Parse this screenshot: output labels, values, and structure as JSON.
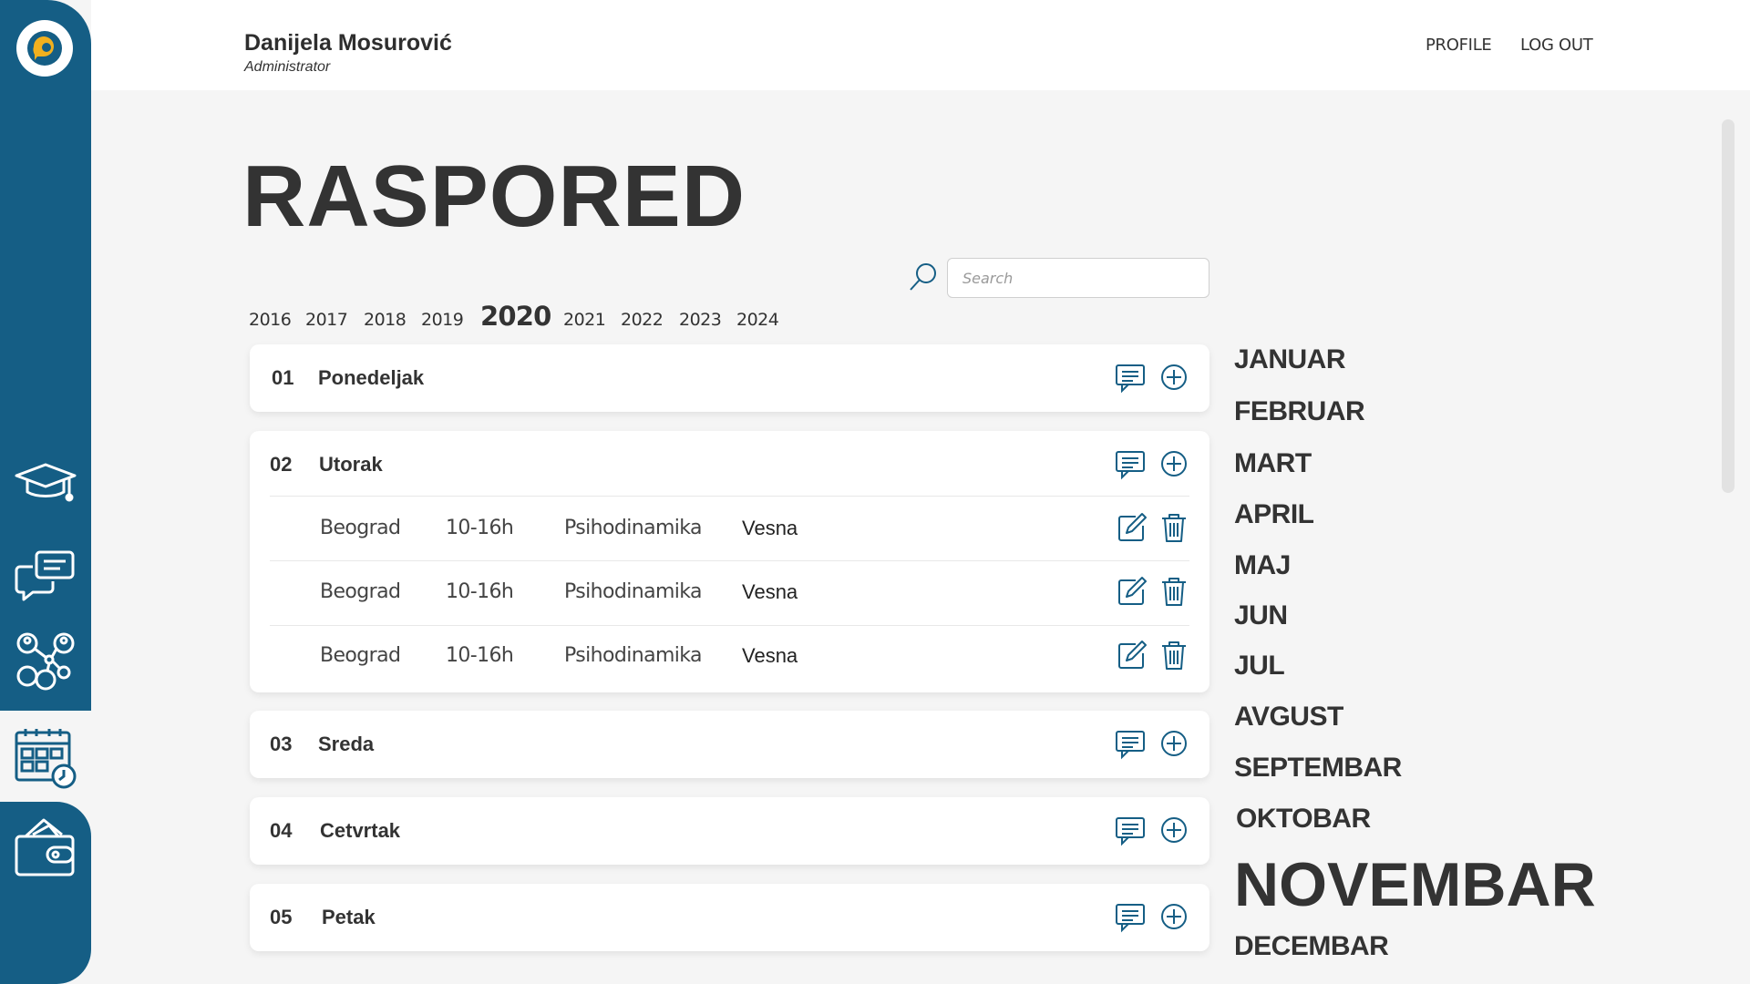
{
  "header": {
    "user_name": "Danijela Mosurović",
    "user_role": "Administrator",
    "profile_label": "PROFILE",
    "logout_label": "LOG OUT"
  },
  "page": {
    "title": "RASPORED"
  },
  "search": {
    "placeholder": "Search"
  },
  "years": {
    "items": [
      "2016",
      "2017",
      "2018",
      "2019",
      "2020",
      "2021",
      "2022",
      "2023",
      "2024"
    ],
    "selected": "2020"
  },
  "days": [
    {
      "num": "01",
      "name": "Ponedeljak",
      "entries": []
    },
    {
      "num": "02",
      "name": "Utorak",
      "entries": [
        {
          "city": "Beograd",
          "time": "10-16h",
          "subject": "Psihodinamika",
          "person": "Vesna"
        },
        {
          "city": "Beograd",
          "time": "10-16h",
          "subject": "Psihodinamika",
          "person": "Vesna"
        },
        {
          "city": "Beograd",
          "time": "10-16h",
          "subject": "Psihodinamika",
          "person": "Vesna"
        }
      ]
    },
    {
      "num": "03",
      "name": "Sreda",
      "entries": []
    },
    {
      "num": "04",
      "name": "Cetvrtak",
      "entries": []
    },
    {
      "num": "05",
      "name": "Petak",
      "entries": []
    }
  ],
  "months": {
    "items": [
      "JANUAR",
      "FEBRUAR",
      "MART",
      "APRIL",
      "MAJ",
      "JUN",
      "JUL",
      "AVGUST",
      "SEPTEMBAR",
      "OKTOBAR",
      "NOVEMBAR",
      "DECEMBAR"
    ],
    "selected": "NOVEMBAR"
  },
  "icons": {
    "sidebar": [
      "logo-icon",
      "graduation-cap-icon",
      "chat-icon",
      "people-network-icon",
      "calendar-clock-icon",
      "wallet-icon"
    ],
    "day_actions": [
      "comment-icon",
      "add-circle-icon"
    ],
    "row_actions": [
      "edit-icon",
      "trash-icon"
    ]
  },
  "colors": {
    "brand": "#155e85",
    "accent_yellow": "#f2b01e",
    "background": "#f5f5f5",
    "text": "#333333"
  }
}
